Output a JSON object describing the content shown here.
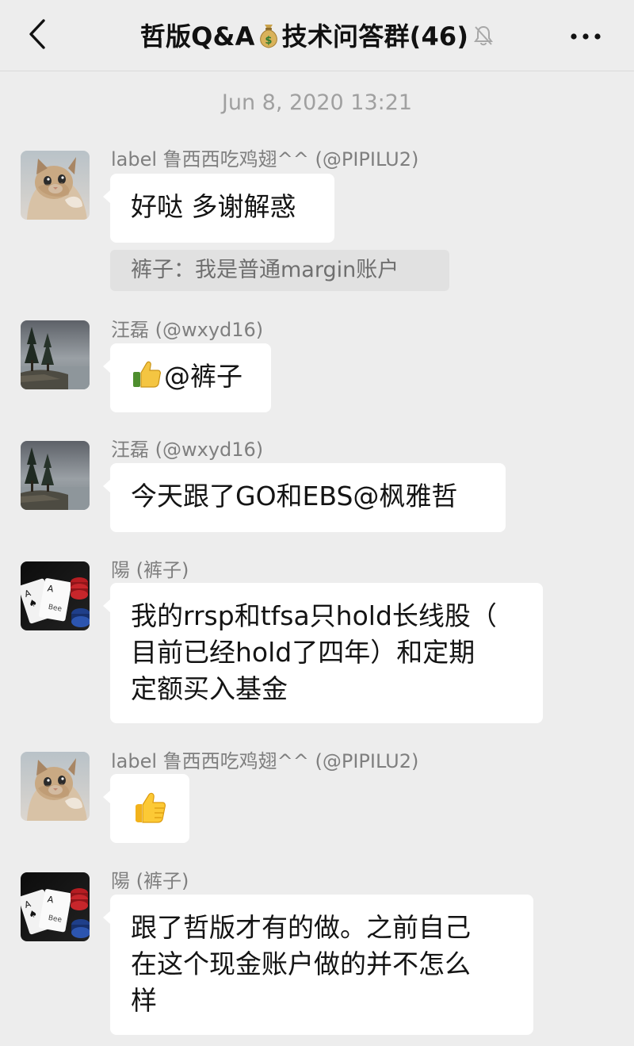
{
  "header": {
    "title": "哲版Q&A💰技术问答群(46)",
    "title_prefix": "哲版Q&A",
    "title_money_icon": "money-bag-icon",
    "title_suffix": "技术问答群(46)",
    "muted_icon": "bell-off-icon",
    "back_icon": "chevron-left-icon",
    "more_icon": "ellipsis-icon"
  },
  "timestamp": "Jun 8, 2020 13:21",
  "messages": [
    {
      "sender": "label 鲁西西吃鸡翅^^ (@PIPILU2)",
      "avatar": "cat-avatar",
      "text": "好哒 多谢解惑",
      "quote": "裤子：我是普通margin账户"
    },
    {
      "sender": "汪磊 (@wxyd16)",
      "avatar": "lake-trees-avatar",
      "emoji": "thumbs-up-icon",
      "text": "@裤子"
    },
    {
      "sender": "汪磊 (@wxyd16)",
      "avatar": "lake-trees-avatar",
      "text": "今天跟了GO和EBS@枫雅哲"
    },
    {
      "sender": "陽 (裤子)",
      "avatar": "playing-cards-avatar",
      "lines": [
        "我的rrsp和tfsa只hold长线股（",
        "目前已经hold了四年）和定期",
        "定额买入基金"
      ]
    },
    {
      "sender": "label 鲁西西吃鸡翅^^ (@PIPILU2)",
      "avatar": "cat-avatar",
      "emoji": "thumbs-up-icon"
    },
    {
      "sender": "陽 (裤子)",
      "avatar": "playing-cards-avatar",
      "lines": [
        "跟了哲版才有的做。之前自己",
        "在这个现金账户做的并不怎么",
        "样"
      ]
    }
  ],
  "colors": {
    "background": "#ededed",
    "bubble": "#ffffff",
    "quote_background": "#e1e1e1",
    "sender_text": "#7f7f7f",
    "timestamp_text": "#a0a0a0"
  }
}
